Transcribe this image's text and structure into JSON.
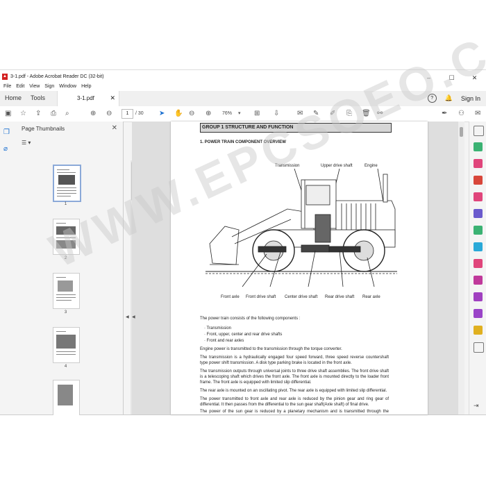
{
  "window": {
    "title": "3-1.pdf - Adobe Acrobat Reader DC (32-bit)",
    "min": "–",
    "max": "☐",
    "close": "✕"
  },
  "menu": [
    "File",
    "Edit",
    "View",
    "Sign",
    "Window",
    "Help"
  ],
  "tabs": {
    "home": "Home",
    "tools": "Tools",
    "doc": "3-1.pdf",
    "doc_close": "✕",
    "sign_in": "Sign In"
  },
  "toolbar": {
    "page_current": "1",
    "page_total": "/ 30",
    "zoom": "76%"
  },
  "thumbnails": {
    "title": "Page Thumbnails",
    "pages": [
      "1",
      "2",
      "3",
      "4"
    ]
  },
  "page": {
    "group_heading": "GROUP  1  STRUCTURE AND FUNCTION",
    "section_heading": "1.  POWER TRAIN COMPONENT OVERVIEW",
    "labels": {
      "transmission": "Transmission",
      "upper_drive_shaft": "Upper drive shaft",
      "engine": "Engine",
      "front_axle": "Front axle",
      "front_drive_shaft": "Front drive shaft",
      "center_drive_shaft": "Center drive shaft",
      "rear_drive_shaft": "Rear drive shaft",
      "rear_axle": "Rear axle"
    },
    "intro": "The power train consists of the following components :",
    "bullets": [
      "·  Transmission",
      "·  Front, upper, center and rear drive shafts",
      "·  Front and rear axles"
    ],
    "paragraphs": [
      "Engine power is transmitted to the transmission through the torque converter.",
      "The transmission is a hydraulically engaged four speed forward, three speed reverse countershaft type power shift transmission.   A disk type parking brake is located in the front axle.",
      "The transmission outputs through universal joints to three drive shaft assemblies.   The front drive shaft is a telescoping shaft which drives the front axle.   The front axle is mounted directly to the loader front frame.   The front axle is equipped with limited slip differential.",
      "The rear axle is mounted on an oscillating pivot.   The rear axle is equipped with limited slip differential.",
      "The power transmitted to front axle and rear axle is reduced by the pinion gear and ring gear of differential.   It then passes from the differential to the sun gear shaft(Axle shaft) of final drive.",
      "The power of the sun gear is reduced by a planetary mechanism and is transmitted through the planetary hub to the wheel."
    ]
  },
  "watermark": "WWW.EPCSOEO.COM",
  "colors": {
    "accent": "#1a6fd0",
    "acrobat_red": "#d32020"
  }
}
